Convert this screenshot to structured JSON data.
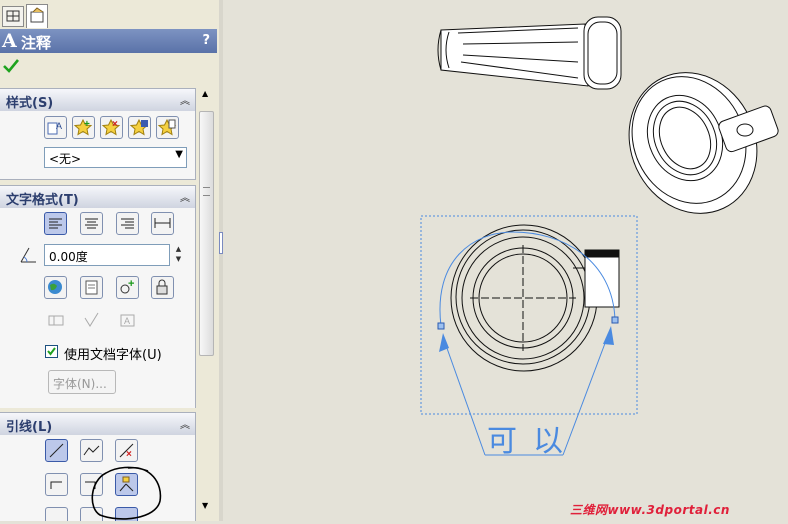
{
  "panel": {
    "title_icon": "A",
    "title": "注释",
    "help": "?",
    "ok_icon": "checkmark-icon"
  },
  "style_section": {
    "label": "样式(S)",
    "dropdown_value": "<无>"
  },
  "text_format_section": {
    "label": "文字格式(T)",
    "angle_value": "0.00度",
    "use_doc_font_label": "使用文档字体(U)",
    "use_doc_font_checked": true,
    "font_button": "字体(N)..."
  },
  "leader_section": {
    "label": "引线(L)"
  },
  "drawing": {
    "annotation_text": "可以"
  },
  "watermark": "三维网www.3dportal.cn",
  "colors": {
    "title_bar": "#6880b8",
    "section_header_text": "#2c3e6e",
    "annotation": "#4a8ae0",
    "watermark": "#e0203a"
  }
}
